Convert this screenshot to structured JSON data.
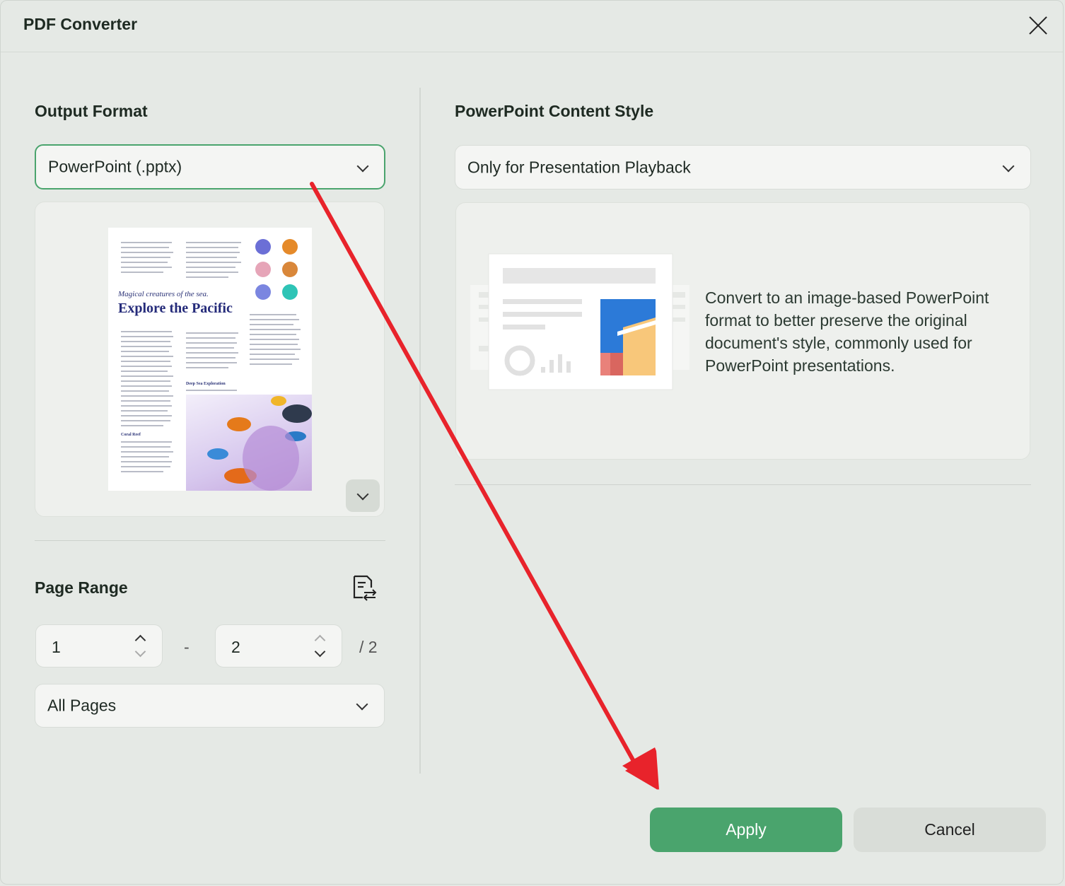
{
  "window": {
    "title": "PDF Converter"
  },
  "output_format": {
    "heading": "Output Format",
    "selected": "PowerPoint (.pptx)"
  },
  "preview": {
    "tagline": "Magical creatures of the sea.",
    "headline": "Explore the Pacific",
    "subhead_1": "Deep Sea Exploration",
    "subhead_2": "Coral Reef"
  },
  "page_range": {
    "heading": "Page Range",
    "from": "1",
    "separator": "-",
    "to": "2",
    "total": "/ 2",
    "mode": "All Pages"
  },
  "content_style": {
    "heading": "PowerPoint Content Style",
    "selected": "Only for Presentation Playback",
    "description": "Convert to an image-based PowerPoint format to better preserve the original document's style, commonly used for PowerPoint presentations."
  },
  "buttons": {
    "apply": "Apply",
    "cancel": "Cancel"
  },
  "colors": {
    "accent": "#4aa46d",
    "annotation_arrow": "#e8232b"
  }
}
